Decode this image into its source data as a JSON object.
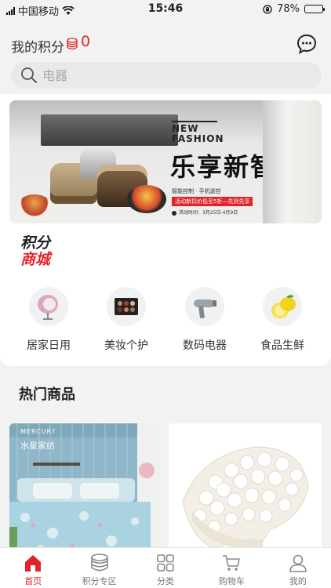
{
  "status_bar": {
    "carrier": "中国移动",
    "time": "15:46",
    "battery": "78%",
    "battery_level": 0.78
  },
  "header": {
    "points_label": "我的积分",
    "points_value": "0"
  },
  "search": {
    "placeholder": "电器"
  },
  "banner": {
    "tag": "NEW FASHION",
    "headline": "乐享新智能",
    "subline": "智能控制 · 手机遥控",
    "promo": "活动新扣价低至5折—先到先享",
    "date": "活动时间：3月25日-4月9日"
  },
  "mall_logo": {
    "line1": "积分",
    "line2": "商城"
  },
  "categories": [
    {
      "label": "居家日用",
      "icon": "egg-chair-icon"
    },
    {
      "label": "美妆个护",
      "icon": "eyeshadow-palette-icon"
    },
    {
      "label": "数码电器",
      "icon": "hair-dryer-icon"
    },
    {
      "label": "食品生鲜",
      "icon": "lemon-icon"
    }
  ],
  "hot_section": {
    "title": "热门商品"
  },
  "products": [
    {
      "brand_text": "水星家纺",
      "brand_en": "MERCURY",
      "icon": "bedding-image"
    },
    {
      "icon": "latex-pillow-image"
    }
  ],
  "tabbar": [
    {
      "label": "首页",
      "icon": "home-icon",
      "active": true
    },
    {
      "label": "积分专区",
      "icon": "coins-icon",
      "active": false
    },
    {
      "label": "分类",
      "icon": "grid-icon",
      "active": false
    },
    {
      "label": "购物车",
      "icon": "cart-icon",
      "active": false
    },
    {
      "label": "我的",
      "icon": "user-icon",
      "active": false
    }
  ],
  "colors": {
    "accent": "#e0242a",
    "background": "#f2f2f2"
  }
}
